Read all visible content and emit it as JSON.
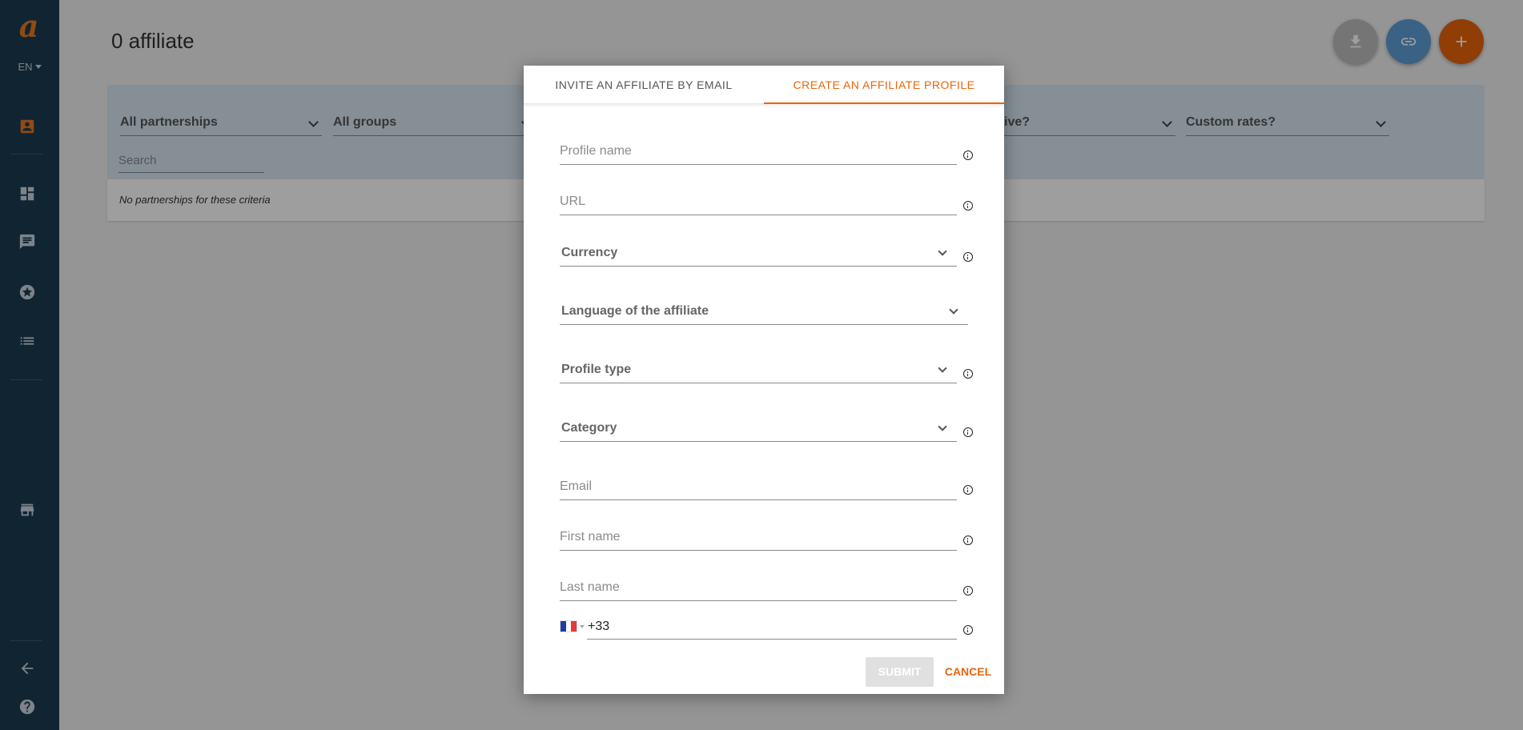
{
  "sidebar": {
    "logo": "a",
    "language": "EN",
    "icons": [
      "contacts-icon",
      "dashboard-icon",
      "messages-icon",
      "star-badge-icon",
      "list-icon",
      "store-icon",
      "back-arrow-icon",
      "help-icon"
    ],
    "active_icon": "contacts-icon",
    "accent_color": "#e8781e",
    "background_color": "#1b3a52"
  },
  "page": {
    "title": "0 affiliate"
  },
  "actions": {
    "download_icon": "download-icon",
    "link_icon": "link-icon",
    "add_icon": "add-icon"
  },
  "filters": {
    "partnerships": "All partnerships",
    "groups": "All groups",
    "active_partial": "ive?",
    "custom_rates": "Custom rates?",
    "search_placeholder": "Search"
  },
  "results": {
    "empty_message": "No partnerships for these criteria"
  },
  "modal": {
    "tabs": [
      {
        "label": "INVITE AN AFFILIATE BY EMAIL",
        "active": false
      },
      {
        "label": "CREATE AN AFFILIATE PROFILE",
        "active": true
      }
    ],
    "fields": {
      "profile_name": "Profile name",
      "url": "URL",
      "currency": "Currency",
      "language": "Language of the affiliate",
      "profile_type": "Profile type",
      "category": "Category",
      "email": "Email",
      "first_name": "First name",
      "last_name": "Last name"
    },
    "phone": {
      "country": "FR",
      "code": "+33"
    },
    "submit_label": "SUBMIT",
    "cancel_label": "CANCEL",
    "accent_color": "#e8650a"
  }
}
